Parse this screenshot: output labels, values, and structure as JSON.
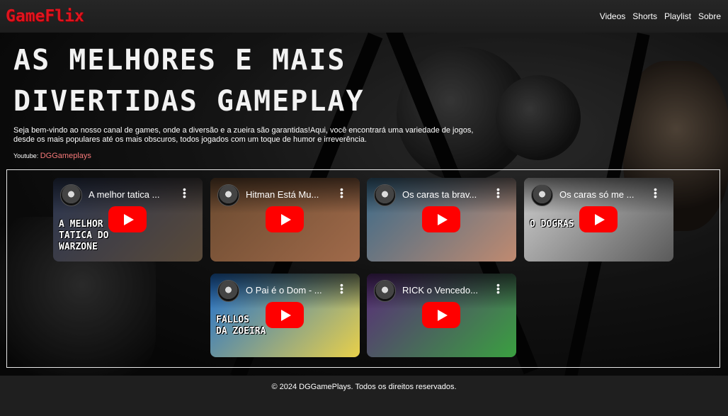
{
  "header": {
    "logo": "GameFlix",
    "nav": [
      "Videos",
      "Shorts",
      "Playlist",
      "Sobre"
    ]
  },
  "hero": {
    "title_line1": "AS MELHORES E MAIS",
    "title_line2": "DIVERTIDAS GAMEPLAY",
    "description": "Seja bem-vindo ao nosso canal de games, onde a diversão e a zueira são garantidas!Aqui, você encontrará uma variedade de jogos, desde os mais populares até os mais obscuros, todos jogados com um toque de humor e irreverência.",
    "youtube_label": "Youtube:",
    "youtube_channel": "DGGameplays"
  },
  "videos": [
    {
      "title": "A melhor tatica ...",
      "thumb_text": "A MELHOR\nTATICA DO\nWARZONE",
      "colors": [
        "#2a3550",
        "#5a4a3a"
      ]
    },
    {
      "title": "Hitman Está Mu...",
      "thumb_text": "",
      "colors": [
        "#6a4a30",
        "#a06a4a"
      ]
    },
    {
      "title": "Os caras ta brav...",
      "thumb_text": "",
      "colors": [
        "#3a6a8a",
        "#c08a70"
      ]
    },
    {
      "title": "Os caras só me ...",
      "thumb_text": "O DOGRAS",
      "colors": [
        "#cfcfcf",
        "#5a5a5a"
      ]
    },
    {
      "title": "O Pai é o Dom - ...",
      "thumb_text": "FALLOS\nDA ZOEIRA",
      "colors": [
        "#1e6fd0",
        "#e8d04a"
      ]
    },
    {
      "title": "RICK o Vencedo...",
      "thumb_text": "",
      "colors": [
        "#5a2a7a",
        "#3aa040"
      ]
    }
  ],
  "footer": {
    "text": "© 2024 DGGamePlays. Todos os direitos reservados."
  }
}
